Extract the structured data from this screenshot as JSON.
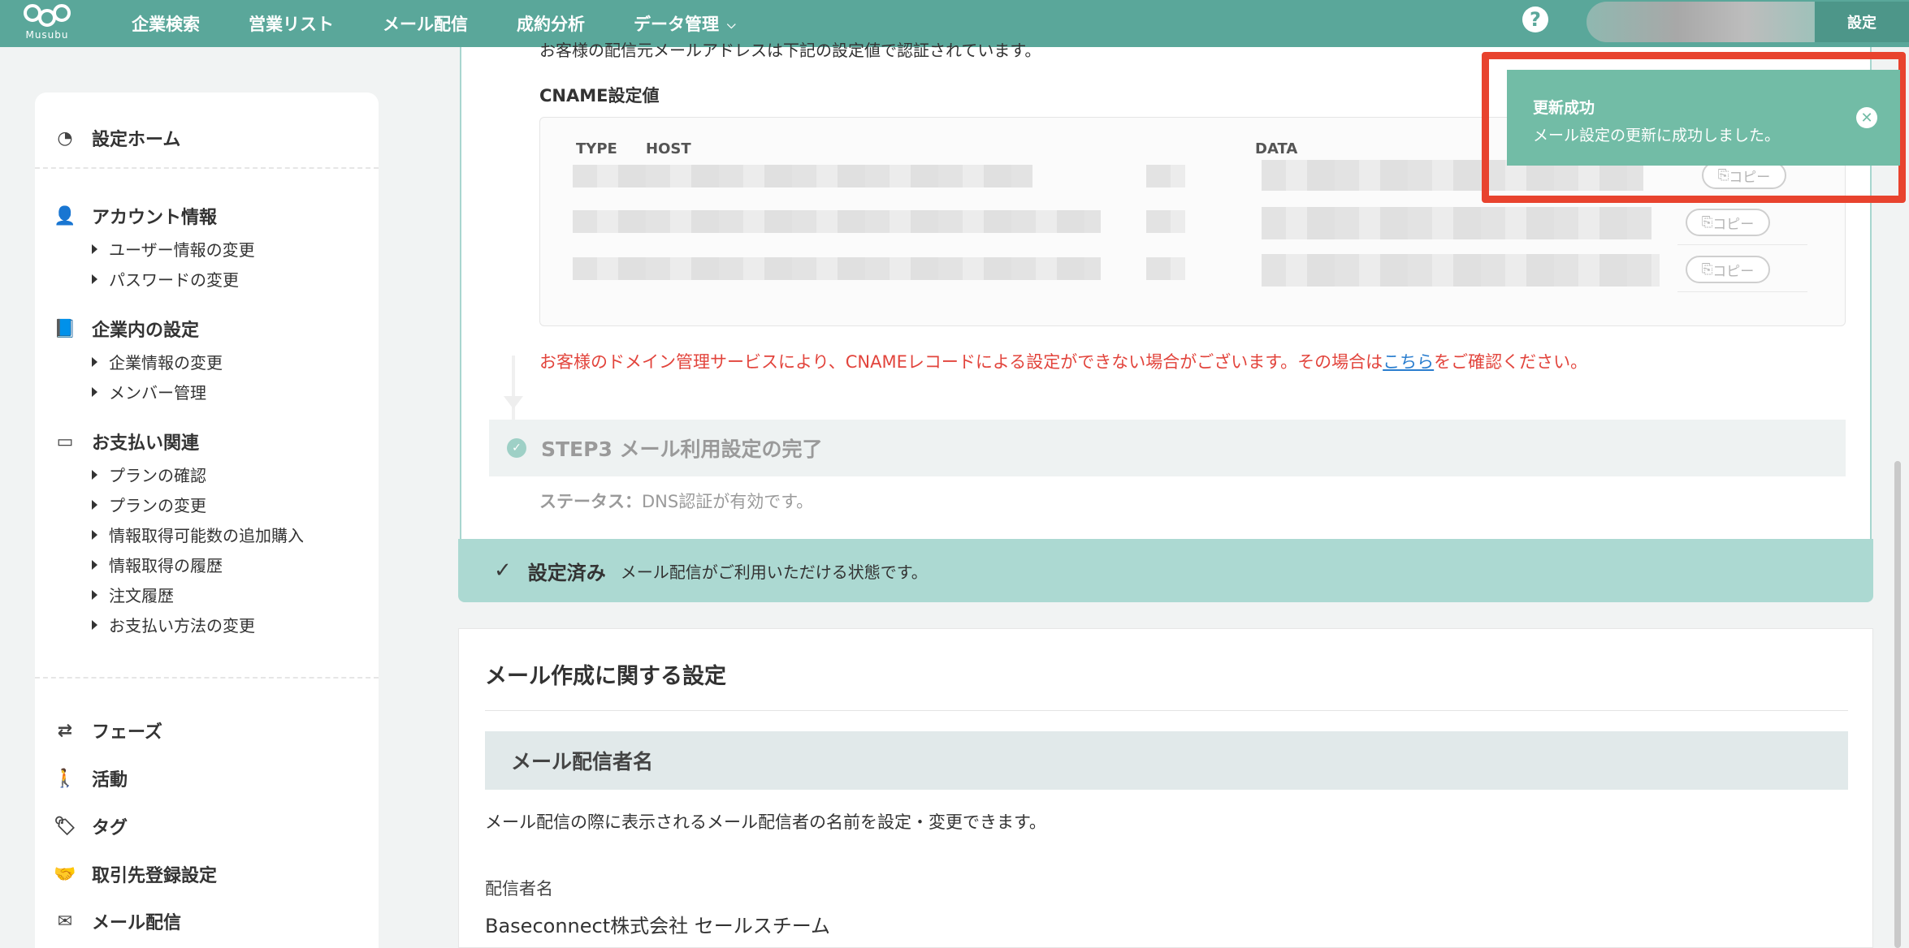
{
  "brand": {
    "name": "Musubu",
    "color": "#5aa79a"
  },
  "nav": {
    "items": [
      "企業検索",
      "営業リスト",
      "メール配信",
      "成約分析",
      "データ管理"
    ],
    "settings_label": "設定"
  },
  "sidebar": {
    "home": "設定ホーム",
    "account": {
      "title": "アカウント情報",
      "items": [
        "ユーザー情報の変更",
        "パスワードの変更"
      ]
    },
    "company": {
      "title": "企業内の設定",
      "items": [
        "企業情報の変更",
        "メンバー管理"
      ]
    },
    "payment": {
      "title": "お支払い関連",
      "items": [
        "プランの確認",
        "プランの変更",
        "情報取得可能数の追加購入",
        "情報取得の履歴",
        "注文履歴",
        "お支払い方法の変更"
      ]
    },
    "bottom": [
      "フェーズ",
      "活動",
      "タグ",
      "取引先登録設定",
      "メール配信"
    ]
  },
  "dns": {
    "cut_text": "お客様の配信元メールアドレスは下記の設定値で認証されています。",
    "cname_title": "CNAME設定値",
    "columns": {
      "type": "TYPE",
      "host": "HOST",
      "data": "DATA"
    },
    "copy_label": "コピー",
    "warning_prefix": "お客様のドメイン管理サービスにより、CNAMEレコードによる設定ができない場合がございます。その場合は",
    "warning_link": "こちら",
    "warning_suffix": "をご確認ください。",
    "step3": "STEP3 メール利用設定の完了",
    "status_label": "ステータス：",
    "status_value": "DNS認証が有効です。"
  },
  "done": {
    "label": "設定済み",
    "message": "メール配信がご利用いただける状態です。"
  },
  "mail_settings": {
    "title": "メール作成に関する設定",
    "sender_heading": "メール配信者名",
    "sender_desc": "メール配信の際に表示されるメール配信者の名前を設定・変更できます。",
    "sender_label": "配信者名",
    "sender_value": "Baseconnect株式会社 セールスチーム"
  },
  "toast": {
    "title": "更新成功",
    "message": "メール設定の更新に成功しました。",
    "color": "#72bca6",
    "highlight_color": "#e8432e"
  }
}
